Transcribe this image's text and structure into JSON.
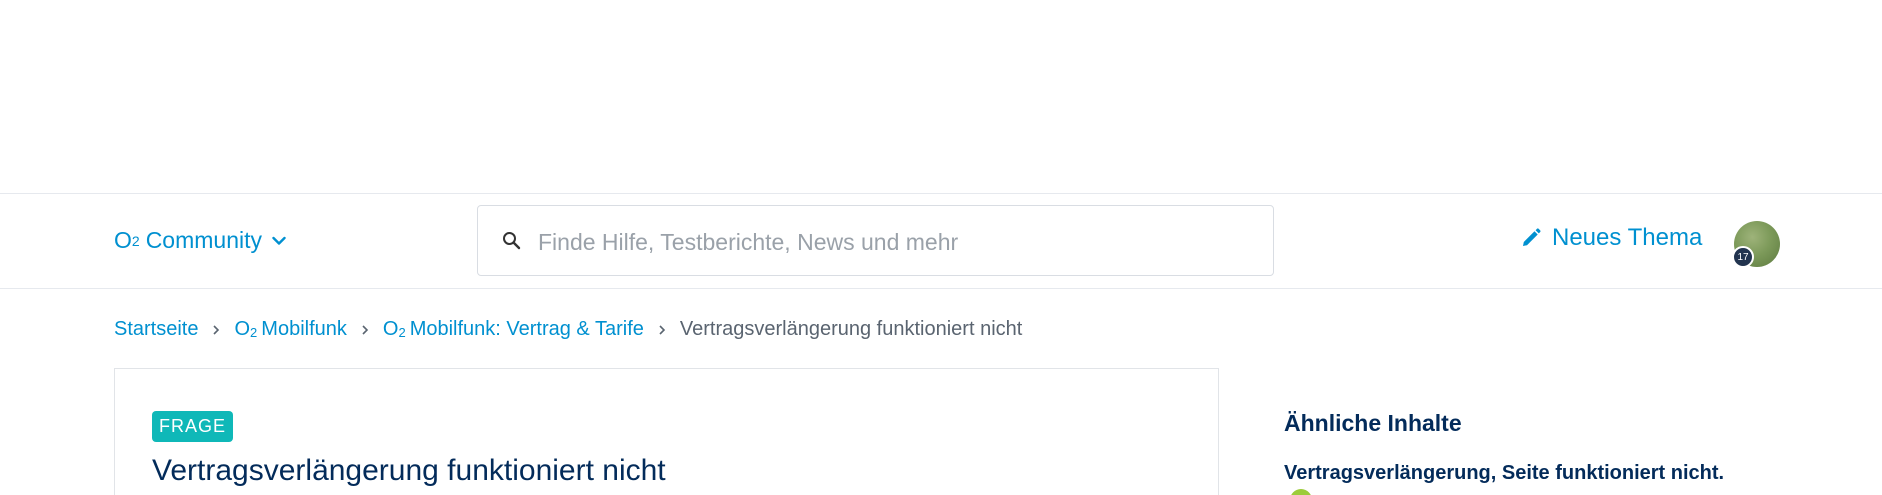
{
  "nav": {
    "brand_prefix": "O",
    "brand_sub": "2",
    "brand_label": "Community",
    "search_placeholder": "Finde Hilfe, Testberichte, News und mehr",
    "new_topic_label": "Neues Thema",
    "avatar_badge": "17",
    "icons": [
      "chevron-down-icon",
      "search-icon",
      "pencil-icon"
    ]
  },
  "breadcrumb": {
    "items": [
      {
        "prefix": "",
        "sub": "",
        "label": "Startseite"
      },
      {
        "prefix": "O",
        "sub": "2",
        "label": "Mobilfunk"
      },
      {
        "prefix": "O",
        "sub": "2",
        "label": "Mobilfunk: Vertrag & Tarife"
      }
    ],
    "current": "Vertragsverlängerung funktioniert nicht"
  },
  "post": {
    "tag": "FRAGE",
    "title": "Vertragsverlängerung funktioniert nicht"
  },
  "sidebar": {
    "heading": "Ähnliche Inhalte",
    "items": [
      {
        "title": "Vertragsverlängerung, Seite funktioniert nicht."
      }
    ]
  },
  "colors": {
    "brand_blue": "#0090d0",
    "navy": "#032b5a",
    "tag_teal": "#0fb8b8",
    "status_green": "#9ccc3a"
  }
}
